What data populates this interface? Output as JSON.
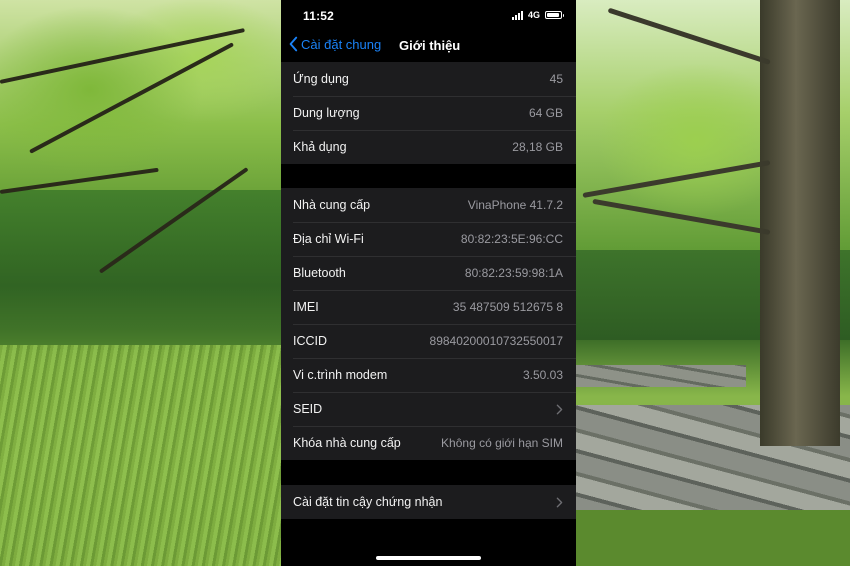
{
  "status_bar": {
    "time": "11:52",
    "network": "4G",
    "battery_level": 0.9
  },
  "nav": {
    "back_label": "Cài đặt chung",
    "title": "Giới thiệu"
  },
  "group1": [
    {
      "label": "Ứng dụng",
      "value": "45"
    },
    {
      "label": "Dung lượng",
      "value": "64 GB"
    },
    {
      "label": "Khả dụng",
      "value": "28,18 GB"
    }
  ],
  "group2": [
    {
      "label": "Nhà cung cấp",
      "value": "VinaPhone 41.7.2"
    },
    {
      "label": "Địa chỉ Wi-Fi",
      "value": "80:82:23:5E:96:CC"
    },
    {
      "label": "Bluetooth",
      "value": "80:82:23:59:98:1A"
    },
    {
      "label": "IMEI",
      "value": "35 487509 512675 8"
    },
    {
      "label": "ICCID",
      "value": "8984020001073255001​7"
    },
    {
      "label": "Vi c.trình modem",
      "value": "3.50.03"
    },
    {
      "label": "SEID",
      "value": ""
    },
    {
      "label": "Khóa nhà cung cấp",
      "value": "Không có giới hạn SIM"
    }
  ],
  "group3": [
    {
      "label": "Cài đặt tin cậy chứng nhận"
    }
  ],
  "icons": {
    "back": "chevron-left-icon",
    "disclosure": "chevron-right-icon"
  },
  "colors": {
    "accent": "#1a82f7",
    "cell": "#1c1c1e",
    "background": "#000000"
  }
}
